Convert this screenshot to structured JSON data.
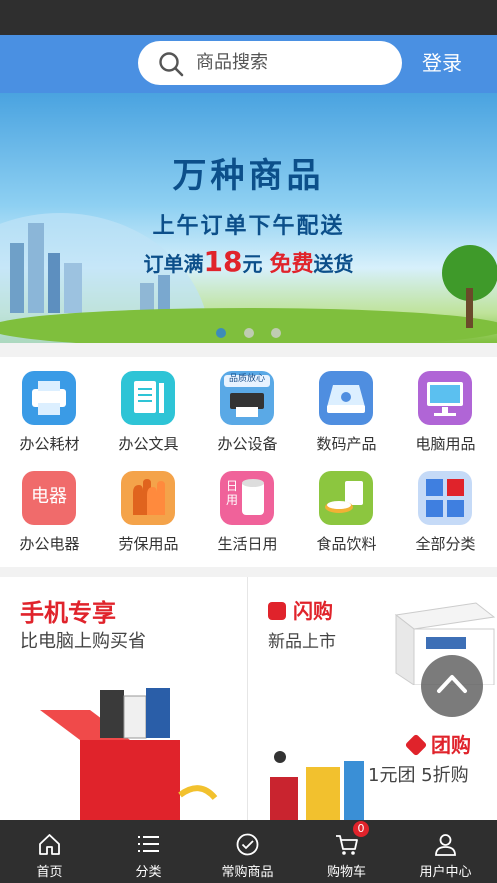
{
  "header": {
    "search_placeholder": "商品搜索",
    "login_label": "登录"
  },
  "banner": {
    "title": "万种商品",
    "subtitle": "上午订单下午配送",
    "offer_prefix": "订单满",
    "offer_amount": "18",
    "offer_unit": "元",
    "offer_free": "免费",
    "offer_suffix": "送货",
    "active_slide": 1,
    "slide_count": 3
  },
  "categories": [
    {
      "label": "办公耗材",
      "icon": "printer-icon",
      "color": "#3a9be6"
    },
    {
      "label": "办公文具",
      "icon": "notebook-icon",
      "color": "#2ec4d6"
    },
    {
      "label": "办公设备",
      "icon": "office-device-icon",
      "color": "#5aa9e6",
      "badge": "品质放心"
    },
    {
      "label": "数码产品",
      "icon": "hard-drive-icon",
      "color": "#4f8ee0"
    },
    {
      "label": "电脑用品",
      "icon": "monitor-icon",
      "color": "#b065d6"
    },
    {
      "label": "办公电器",
      "icon": "appliance-icon",
      "color": "#f06b6b",
      "badge": "电器"
    },
    {
      "label": "劳保用品",
      "icon": "gloves-icon",
      "color": "#f4a34a"
    },
    {
      "label": "生活日用",
      "icon": "tissue-roll-icon",
      "color": "#f0629a",
      "badge": "日用"
    },
    {
      "label": "食品饮料",
      "icon": "food-icon",
      "color": "#8cc63f"
    },
    {
      "label": "全部分类",
      "icon": "grid-icon",
      "color": "#4a86e8"
    }
  ],
  "promo": {
    "mobile_title": "手机专享",
    "mobile_sub": "比电脑上购买省",
    "flash_title": "闪购",
    "flash_sub": "新品上市",
    "group_title": "团购",
    "group_sub": "1元团 5折购"
  },
  "tabbar": [
    {
      "label": "首页",
      "icon": "home-icon"
    },
    {
      "label": "分类",
      "icon": "list-icon"
    },
    {
      "label": "常购商品",
      "icon": "check-circle-icon"
    },
    {
      "label": "购物车",
      "icon": "cart-icon",
      "badge": "0"
    },
    {
      "label": "用户中心",
      "icon": "user-icon"
    }
  ],
  "colors": {
    "accent": "#4a90e2",
    "red": "#e0232b",
    "dark": "#2f2f2f"
  }
}
